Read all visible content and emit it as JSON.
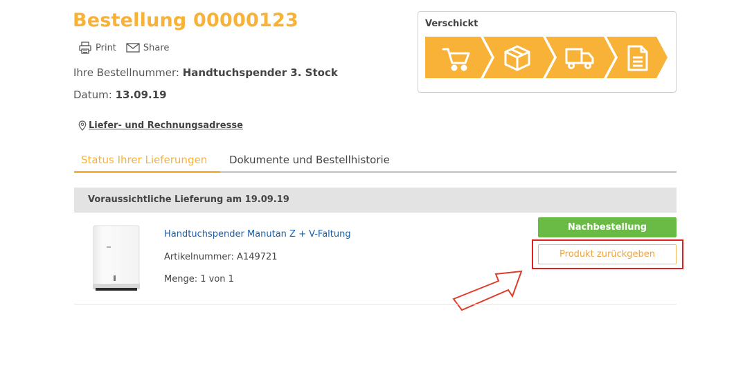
{
  "order": {
    "title": "Bestellung 00000123",
    "print_label": "Print",
    "share_label": "Share",
    "number_label": "Ihre Bestellnummer:",
    "number_value": "Handtuchspender 3. Stock",
    "date_label": "Datum:",
    "date_value": "13.09.19",
    "address_link": "Liefer- und Rechnungsadresse"
  },
  "status": {
    "label": "Verschickt",
    "steps": [
      "cart-icon",
      "package-icon",
      "truck-icon",
      "document-icon"
    ],
    "accent_color": "#f7b237"
  },
  "tabs": [
    {
      "label": "Status Ihrer Lieferungen",
      "active": true
    },
    {
      "label": "Dokumente und Bestellhistorie",
      "active": false
    }
  ],
  "delivery": {
    "heading": "Voraussichtliche Lieferung am 19.09.19"
  },
  "product": {
    "name": "Handtuchspender Manutan Z + V-Faltung",
    "article": "Artikelnummer: A149721",
    "quantity": "Menge: 1 von 1"
  },
  "buttons": {
    "reorder": "Nachbestellung",
    "return": "Produkt zurückgeben"
  },
  "colors": {
    "accent": "#f7b237",
    "reorder_green": "#6abb46",
    "link_blue": "#1a5fa8",
    "highlight_red": "#e02020"
  }
}
